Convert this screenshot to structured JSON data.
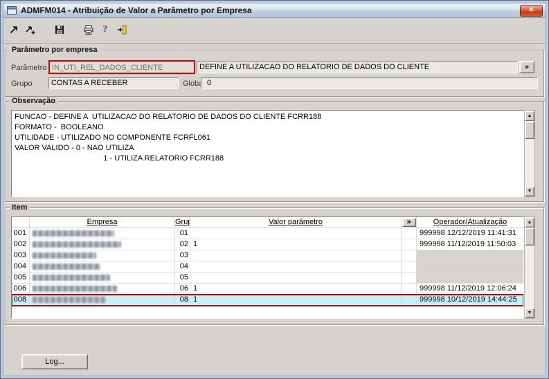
{
  "window": {
    "title": "ADMFM014 - Atribuição de Valor a Parâmetro por Empresa"
  },
  "toolbar": {
    "icons": [
      "zoom-arrow-icon",
      "add-record-icon",
      "save-icon",
      "print-icon",
      "help-icon",
      "exit-icon"
    ],
    "help_glyph": "?"
  },
  "parametro_group": {
    "title": "Parâmetro por empresa",
    "parametro_label": "Parâmetro",
    "parametro_value": "IN_UTI_REL_DADOS_CLIENTE",
    "descricao_value": "DEFINE A  UTILIZACAO DO RELATORIO DE DADOS DO CLIENTE",
    "expand_button_label": "»",
    "grupo_label": "Grupo",
    "grupo_value": "CONTAS A RECEBER",
    "global_label": "Global",
    "global_value": "0"
  },
  "observacao_group": {
    "title": "Observação",
    "text": "FUNCAO - DEFINE A  UTILIZACAO DO RELATORIO DE DADOS DO CLIENTE FCRR188\nFORMATO -  BOOLEANO\nUTILIDADE - UTILIZADO NO COMPONENTE FCRFL061\nVALOR VALIDO - 0 - NAO UTILIZA\n                                          1 - UTILIZA RELATORIO FCRR188"
  },
  "item_group": {
    "title": "Item",
    "columns": {
      "empresa": "Empresa",
      "grupo": "Grupo",
      "valor": "Valor parâmetro",
      "expand": "»",
      "operador": "Operador/Atualização"
    },
    "rows": [
      {
        "num": "001",
        "grupo": "01",
        "valor": "",
        "operador": "999998 12/12/2019 11:41:31",
        "dim": false,
        "highlight": false
      },
      {
        "num": "002",
        "grupo": "02",
        "valor": "1",
        "operador": "999998 11/12/2019 11:50:03",
        "dim": false,
        "highlight": false
      },
      {
        "num": "003",
        "grupo": "03",
        "valor": "",
        "operador": "",
        "dim": true,
        "highlight": false
      },
      {
        "num": "004",
        "grupo": "04",
        "valor": "",
        "operador": "",
        "dim": true,
        "highlight": false
      },
      {
        "num": "005",
        "grupo": "05",
        "valor": "",
        "operador": "",
        "dim": true,
        "highlight": false
      },
      {
        "num": "006",
        "grupo": "06",
        "valor": "1",
        "operador": "999998 11/12/2019 12:06:24",
        "dim": false,
        "highlight": false
      },
      {
        "num": "008",
        "grupo": "08",
        "valor": "1",
        "operador": "999998 10/12/2019 14:44:25",
        "dim": false,
        "highlight": true
      }
    ]
  },
  "footer": {
    "log_label": "Log..."
  }
}
